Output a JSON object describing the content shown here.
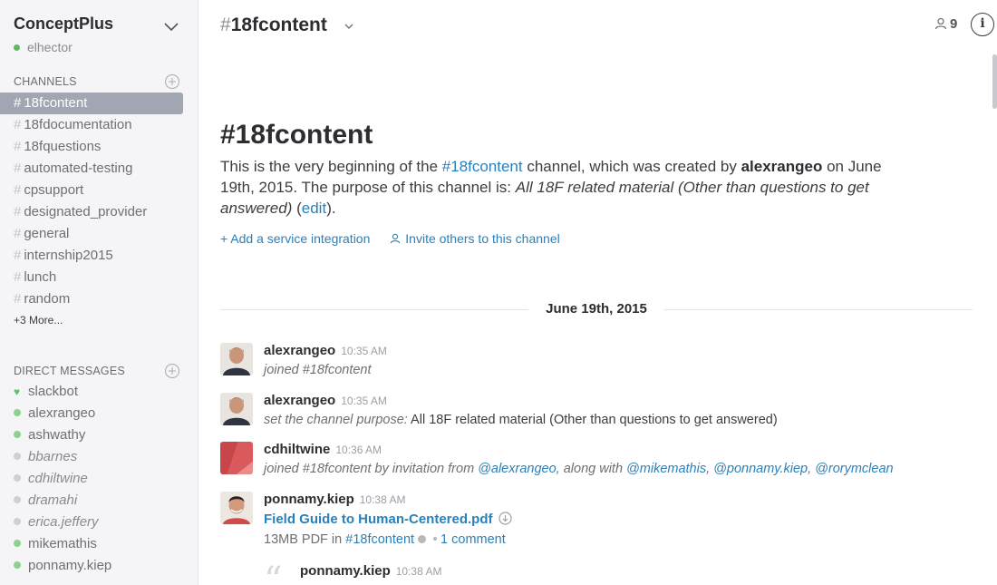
{
  "sidebar": {
    "team_name": "ConceptPlus",
    "current_user": "elhector",
    "channels_title": "CHANNELS",
    "channels": [
      {
        "label": "18fcontent",
        "active": true
      },
      {
        "label": "18fdocumentation"
      },
      {
        "label": "18fquestions"
      },
      {
        "label": "automated-testing"
      },
      {
        "label": "cpsupport"
      },
      {
        "label": "designated_provider"
      },
      {
        "label": "general"
      },
      {
        "label": "internship2015"
      },
      {
        "label": "lunch"
      },
      {
        "label": "random"
      }
    ],
    "more_label": "+3 More...",
    "dm_title": "DIRECT MESSAGES",
    "dms": [
      {
        "label": "slackbot",
        "status": "bot"
      },
      {
        "label": "alexrangeo",
        "status": "online"
      },
      {
        "label": "ashwathy",
        "status": "online"
      },
      {
        "label": "bbarnes",
        "status": "away"
      },
      {
        "label": "cdhiltwine",
        "status": "away"
      },
      {
        "label": "dramahi",
        "status": "away"
      },
      {
        "label": "erica.jeffery",
        "status": "away"
      },
      {
        "label": "mikemathis",
        "status": "online"
      },
      {
        "label": "ponnamy.kiep",
        "status": "online"
      }
    ]
  },
  "header": {
    "hash": "#",
    "channel": "18fcontent",
    "member_count": "9"
  },
  "intro": {
    "title": "#18fcontent",
    "t1": "This is the very beginning of the ",
    "channel_link": "#18fcontent",
    "t2": " channel, which was created by ",
    "creator": "alexrangeo",
    "t3": " on June 19th, 2015. The purpose of this channel is: ",
    "purpose": "All 18F related material (Other than questions to get answered)",
    "t4": " (",
    "edit": "edit",
    "t5": ").",
    "action_integration": "+ Add a service integration",
    "action_invite": "Invite others to this channel"
  },
  "date_divider": "June 19th, 2015",
  "messages": [
    {
      "user": "alexrangeo",
      "time": "10:35 AM",
      "body": "joined #18fcontent"
    },
    {
      "user": "alexrangeo",
      "time": "10:35 AM",
      "label": "set the channel purpose:",
      "text": "All 18F related material (Other than questions to get answered)"
    },
    {
      "user": "cdhiltwine",
      "time": "10:36 AM",
      "body": "joined #18fcontent by invitation from ",
      "m1": "@alexrangeo",
      "sep": ", along with ",
      "m2": "@mikemathis",
      "c1": ", ",
      "m3": "@ponnamy.kiep",
      "c2": ", ",
      "m4": "@rorymclean"
    },
    {
      "user": "ponnamy.kiep",
      "time": "10:38 AM",
      "file": "Field Guide to Human-Centered.pdf",
      "meta": "13MB PDF in ",
      "meta_channel": "#18fcontent",
      "comments": "1 comment"
    }
  ],
  "sub_message": {
    "user": "ponnamy.kiep",
    "time": "10:38 AM"
  },
  "colors": {
    "link": "#2a80b9",
    "active_channel_bg": "#a2a6b3",
    "online": "#8cd28f"
  }
}
